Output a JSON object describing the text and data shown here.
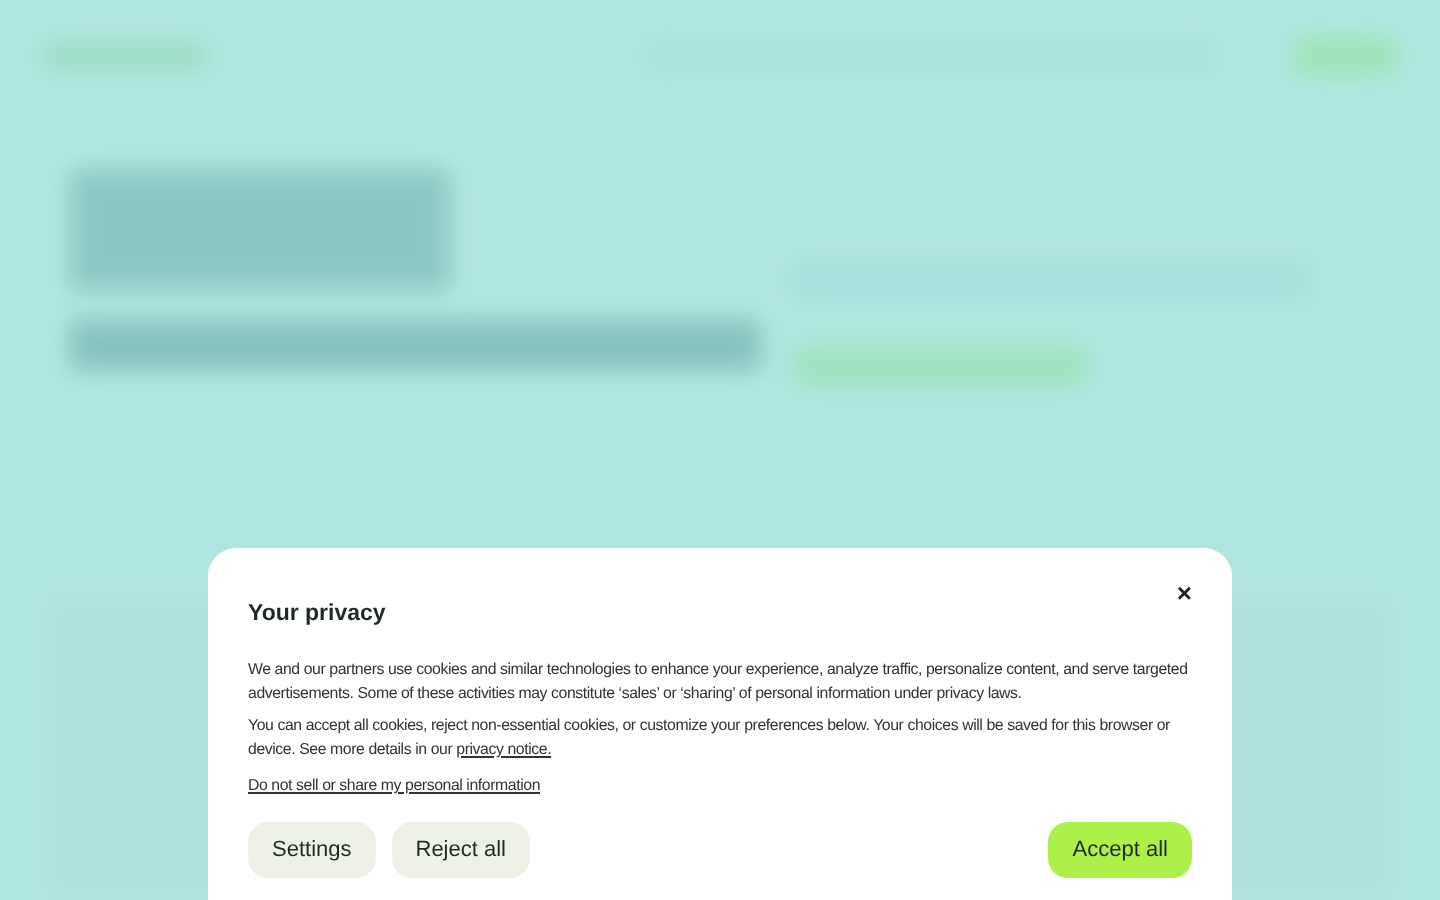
{
  "dialog": {
    "title": "Your privacy",
    "close": "×",
    "paragraphs": [
      "We and our partners use cookies and similar technologies to enhance your experience, analyze traffic, personalize content, and serve targeted advertisements. Some of these activities may constitute ‘sales’ or ‘sharing’ of personal information under privacy laws.",
      "You can accept all cookies, reject non-essential cookies, or customize your preferences below. Your choices will be saved for this browser or device. See more details in our"
    ],
    "privacy_link": "privacy notice.",
    "opt_out_link": "Do not sell or share my personal information",
    "buttons": [
      {
        "label": "Settings",
        "kind": "secondary"
      },
      {
        "label": "Reject all",
        "kind": "secondary"
      },
      {
        "label": "Accept all",
        "kind": "primary"
      }
    ]
  }
}
